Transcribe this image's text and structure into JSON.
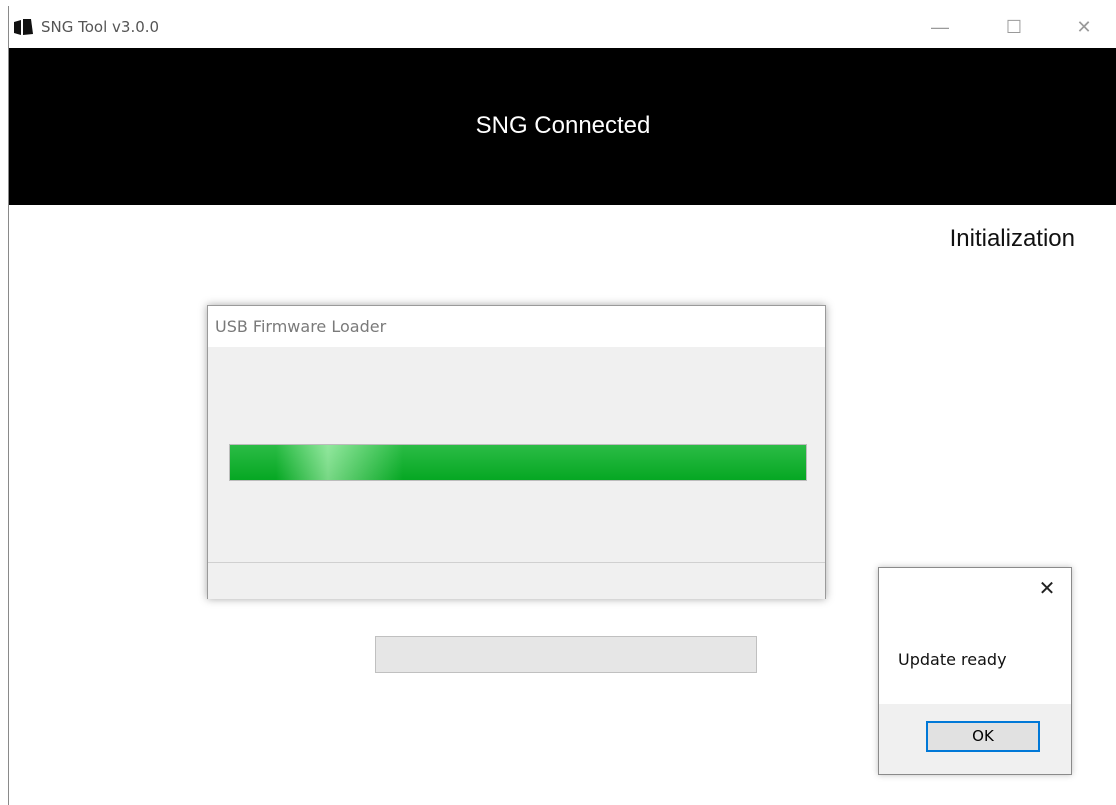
{
  "window": {
    "title": "SNG Tool v3.0.0",
    "controls": {
      "minimize": "—",
      "maximize": "☐",
      "close": "✕"
    }
  },
  "banner": {
    "text": "SNG Connected"
  },
  "main": {
    "stage_label": "Initialization",
    "partially_hidden_text": "",
    "progress": 0
  },
  "loader_dialog": {
    "title": "USB Firmware Loader",
    "progress_percent": 100,
    "status_text": ""
  },
  "message_box": {
    "close": "✕",
    "text": "Update ready",
    "ok_label": "OK"
  },
  "colors": {
    "banner_bg": "#000000",
    "progress_green": "#06b025",
    "focus_blue": "#0078d7"
  },
  "icons": [
    "app-logo-icon",
    "minimize-icon",
    "maximize-icon",
    "close-icon"
  ]
}
